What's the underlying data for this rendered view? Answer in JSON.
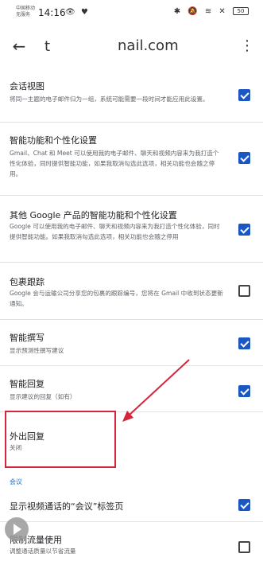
{
  "status_bar": {
    "carrier_line1": "中国移动",
    "carrier_line2": "无服务",
    "time": "14:16",
    "left_icons": "👁 ♥",
    "right_icons": "✱ 🔕 ≋ ✕",
    "battery": "50"
  },
  "app_bar": {
    "back_icon": "←",
    "title_fragment": "t",
    "title": "nail.com",
    "more_icon": "⋮"
  },
  "settings": [
    {
      "title": "会话视图",
      "description": "将同一主题的电子邮件归为一组，系统可能需要一段时间才能应用此设置。",
      "checked": true
    },
    {
      "title": "智能功能和个性化设置",
      "description": "Gmail、Chat 和 Meet 可以使用我的电子邮件、聊天和视频内容来为我打造个性化体验，同时提供智能功能，如果我取消勾选此选项，相关功能也会随之停用。",
      "checked": true
    },
    {
      "title": "其他 Google 产品的智能功能和个性化设置",
      "description": "Google 可以使用我的电子邮件、聊天和视频内容来为我打造个性化体验，同时提供智能功能。如果我取消勾选此选项，相关功能也会随之停用",
      "checked": true
    },
    {
      "title": "包裹跟踪",
      "description": "Google 会与运输公司分享您的包裹的跟踪编号，您将在 Gmail 中收到状态更新通知。",
      "checked": false
    },
    {
      "title": "智能撰写",
      "description": "显示预测性撰写建议",
      "checked": true
    },
    {
      "title": "智能回复",
      "description": "显示建议的回复（如有）",
      "checked": true
    },
    {
      "title": "外出回复",
      "description": "关闭"
    },
    {
      "title": "显示视频通话的“会议”标签页",
      "description": "",
      "checked": true
    },
    {
      "title": "限制流量使用",
      "description": "调整通话质量以节省流量",
      "checked": false
    }
  ],
  "section_meet": "会议",
  "colors": {
    "accent": "#1a73e8",
    "checkbox": "#1a56c4",
    "annotation": "#d6253b"
  }
}
